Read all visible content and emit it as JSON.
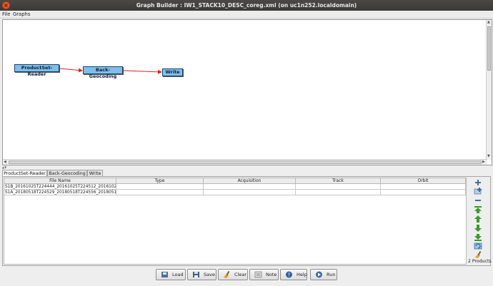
{
  "window": {
    "title": "Graph Builder : IW1_STACK10_DESC_coreg.xml (on uc1n252.localdomain)",
    "close_glyph": "×"
  },
  "menu": {
    "file": "File",
    "graphs": "Graphs"
  },
  "graph": {
    "nodes": [
      {
        "label": "ProductSet-Reader"
      },
      {
        "label": "Back-Geocoding"
      },
      {
        "label": "Write"
      }
    ],
    "edge_color": "#e02020"
  },
  "tabs": [
    {
      "label": "ProductSet-Reader",
      "active": true
    },
    {
      "label": "Back-Geocoding",
      "active": false
    },
    {
      "label": "Write",
      "active": false
    }
  ],
  "table": {
    "headers": [
      "File Name",
      "Type",
      "Acquisition",
      "Track",
      "Orbit"
    ],
    "rows": [
      [
        "S1B_20161025T224444_20161025T224512_2016102...",
        "",
        "",
        "",
        ""
      ],
      [
        "S1A_20180518T224529_20180518T224556_2018051...",
        "",
        "",
        "",
        ""
      ]
    ]
  },
  "side_buttons": [
    "add-icon",
    "add-opened-icon",
    "remove-icon",
    "move-top-icon",
    "move-up-icon",
    "move-down-icon",
    "move-bottom-icon",
    "refresh-icon",
    "clear-icon"
  ],
  "products_label": "2 Products",
  "bottom_buttons": {
    "load": "Load",
    "save": "Save",
    "clear": "Clear",
    "note": "Note",
    "help": "Help",
    "run": "Run"
  },
  "colors": {
    "node_fill": "#7fbfe8",
    "titlebar": "#3e3d39",
    "accent_green": "#3a9a2a"
  }
}
